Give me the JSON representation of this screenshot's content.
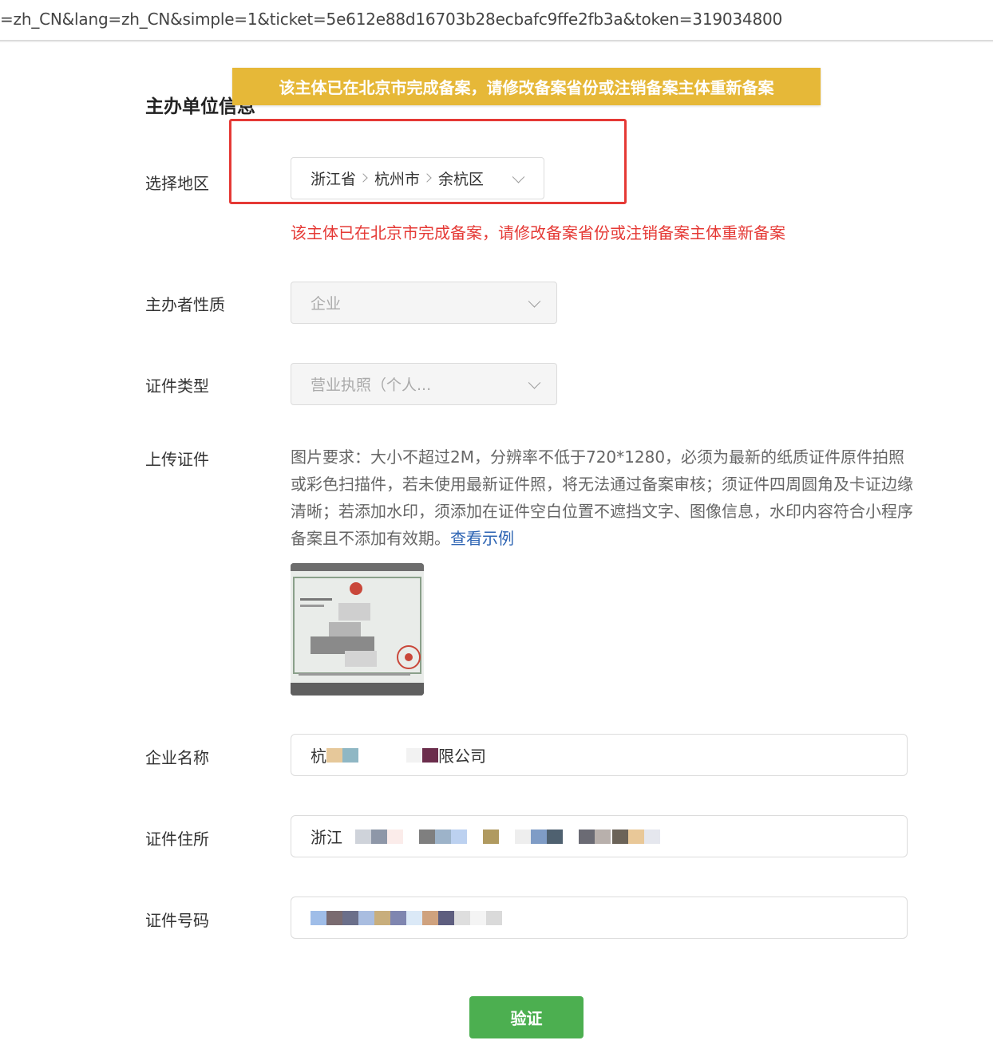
{
  "browser": {
    "url_fragment": "=zh_CN&lang=zh_CN&simple=1&ticket=5e612e88d16703b28ecbafc9ffe2fb3a&token=319034800"
  },
  "toast": {
    "message": "该主体已在北京市完成备案，请修改备案省份或注销备案主体重新备案",
    "color": "#e6b838"
  },
  "section": {
    "title": "主办单位信息"
  },
  "form": {
    "region": {
      "label": "选择地区",
      "province": "浙江省",
      "city": "杭州市",
      "district": "余杭区",
      "error": "该主体已在北京市完成备案，请修改备案省份或注销备案主体重新备案"
    },
    "organizer_type": {
      "label": "主办者性质",
      "value": "企业"
    },
    "cert_type": {
      "label": "证件类型",
      "value": "营业执照（个人..."
    },
    "upload": {
      "label": "上传证件",
      "requirements": "图片要求：大小不超过2M，分辨率不低于720*1280，必须为最新的纸质证件原件拍照或彩色扫描件，若未使用最新证件照，将无法通过备案审核；须证件四周圆角及卡证边缘清晰；若添加水印，须添加在证件空白位置不遮挡文字、图像信息，水印内容符合小程序备案且不添加有效期。",
      "example_link": "查看示例"
    },
    "company_name": {
      "label": "企业名称",
      "value_prefix": "杭",
      "value_suffix": "限公司"
    },
    "cert_address": {
      "label": "证件住所",
      "value_prefix": "浙江"
    },
    "cert_number": {
      "label": "证件号码"
    },
    "verify_button": "验证"
  },
  "colors": {
    "error": "#e53935",
    "link": "#2d64b3",
    "primary_button": "#4caf50"
  }
}
